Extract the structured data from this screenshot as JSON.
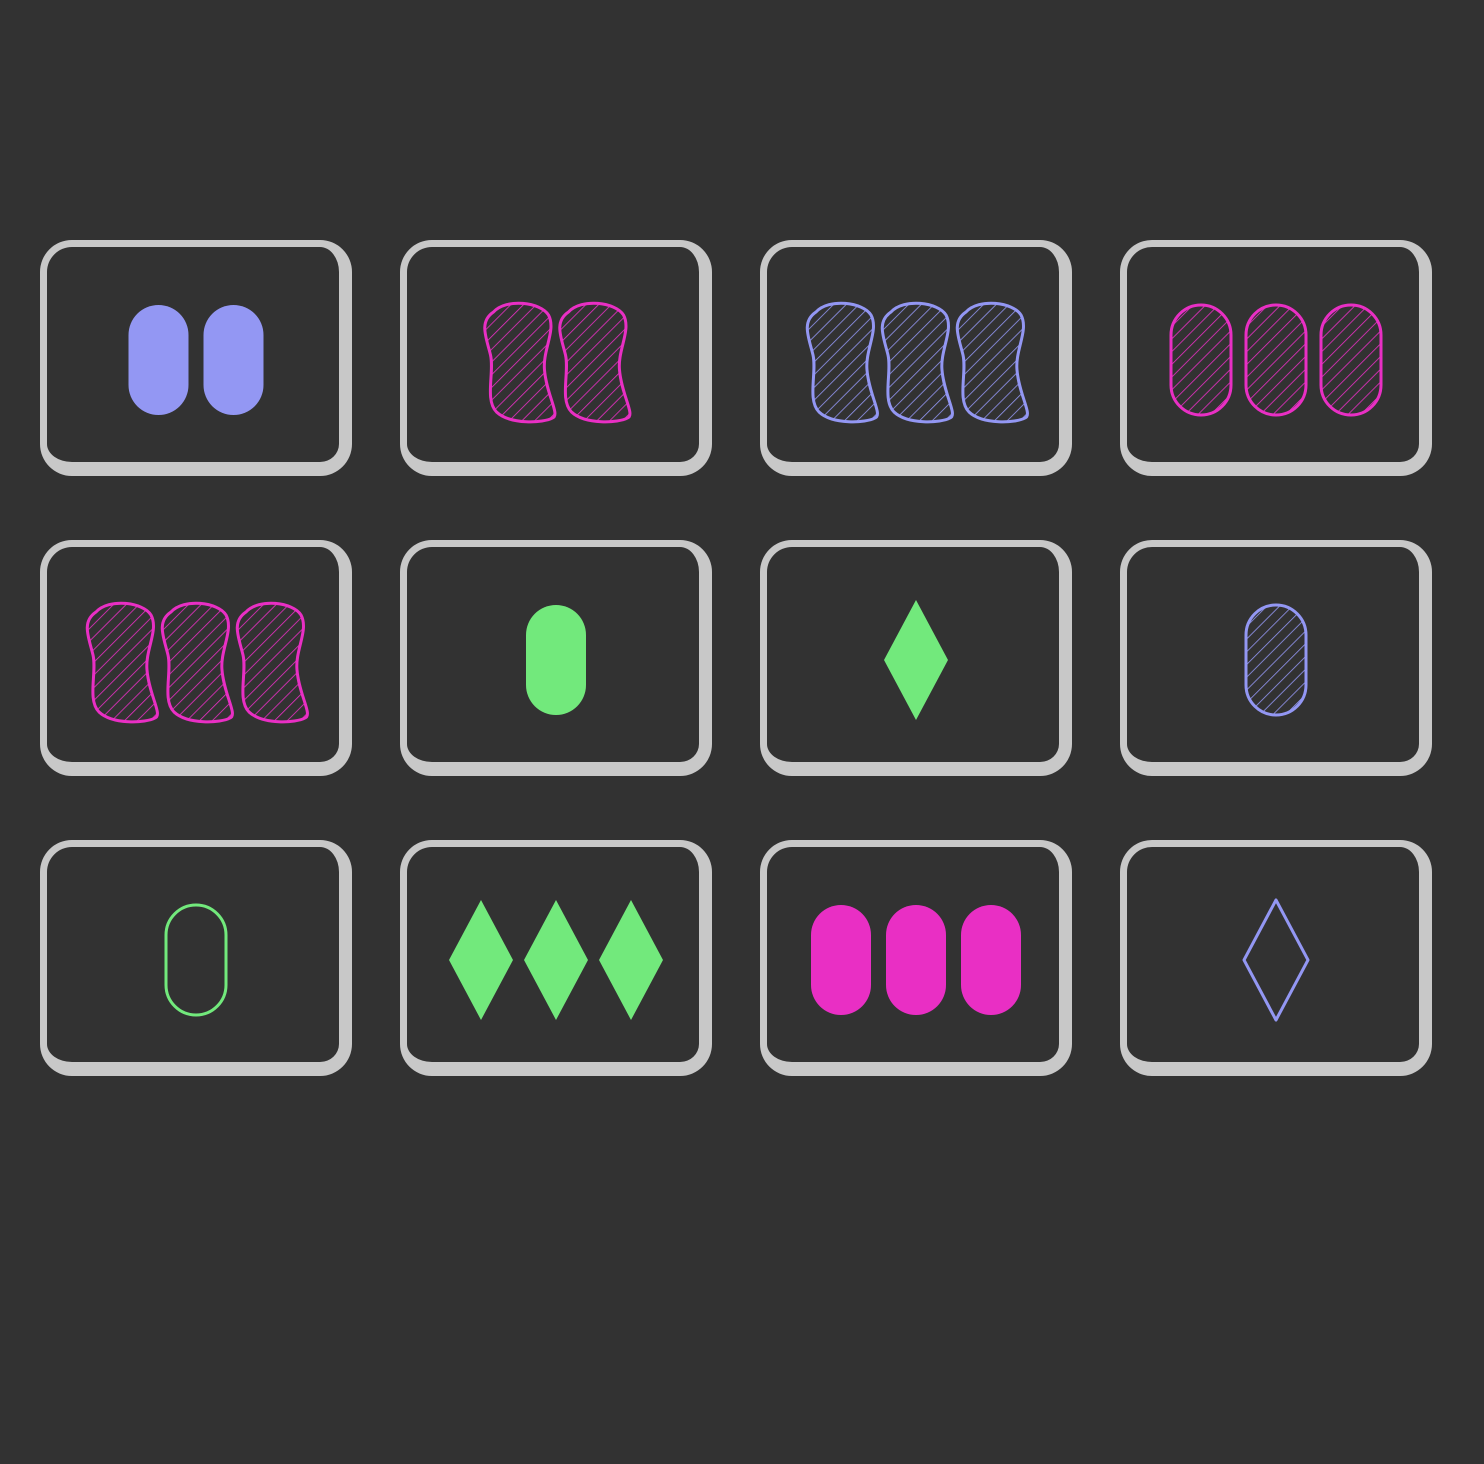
{
  "colors": {
    "background": "#323232",
    "card_border": "#c8c8c8",
    "purple": "#9397f3",
    "magenta": "#e92fc4",
    "green": "#72e97c"
  },
  "cards": [
    {
      "row": 1,
      "col": 1,
      "count": 2,
      "shape": "oval",
      "color": "purple",
      "shading": "solid"
    },
    {
      "row": 1,
      "col": 2,
      "count": 2,
      "shape": "squiggle",
      "color": "magenta",
      "shading": "striped"
    },
    {
      "row": 1,
      "col": 3,
      "count": 3,
      "shape": "squiggle",
      "color": "purple",
      "shading": "striped"
    },
    {
      "row": 1,
      "col": 4,
      "count": 3,
      "shape": "oval",
      "color": "magenta",
      "shading": "striped"
    },
    {
      "row": 2,
      "col": 1,
      "count": 3,
      "shape": "squiggle",
      "color": "magenta",
      "shading": "striped"
    },
    {
      "row": 2,
      "col": 2,
      "count": 1,
      "shape": "oval",
      "color": "green",
      "shading": "solid"
    },
    {
      "row": 2,
      "col": 3,
      "count": 1,
      "shape": "diamond",
      "color": "green",
      "shading": "solid"
    },
    {
      "row": 2,
      "col": 4,
      "count": 1,
      "shape": "oval",
      "color": "purple",
      "shading": "striped"
    },
    {
      "row": 3,
      "col": 1,
      "count": 1,
      "shape": "oval",
      "color": "green",
      "shading": "open"
    },
    {
      "row": 3,
      "col": 2,
      "count": 3,
      "shape": "diamond",
      "color": "green",
      "shading": "solid"
    },
    {
      "row": 3,
      "col": 3,
      "count": 3,
      "shape": "oval",
      "color": "magenta",
      "shading": "solid"
    },
    {
      "row": 3,
      "col": 4,
      "count": 1,
      "shape": "diamond",
      "color": "purple",
      "shading": "open"
    }
  ]
}
